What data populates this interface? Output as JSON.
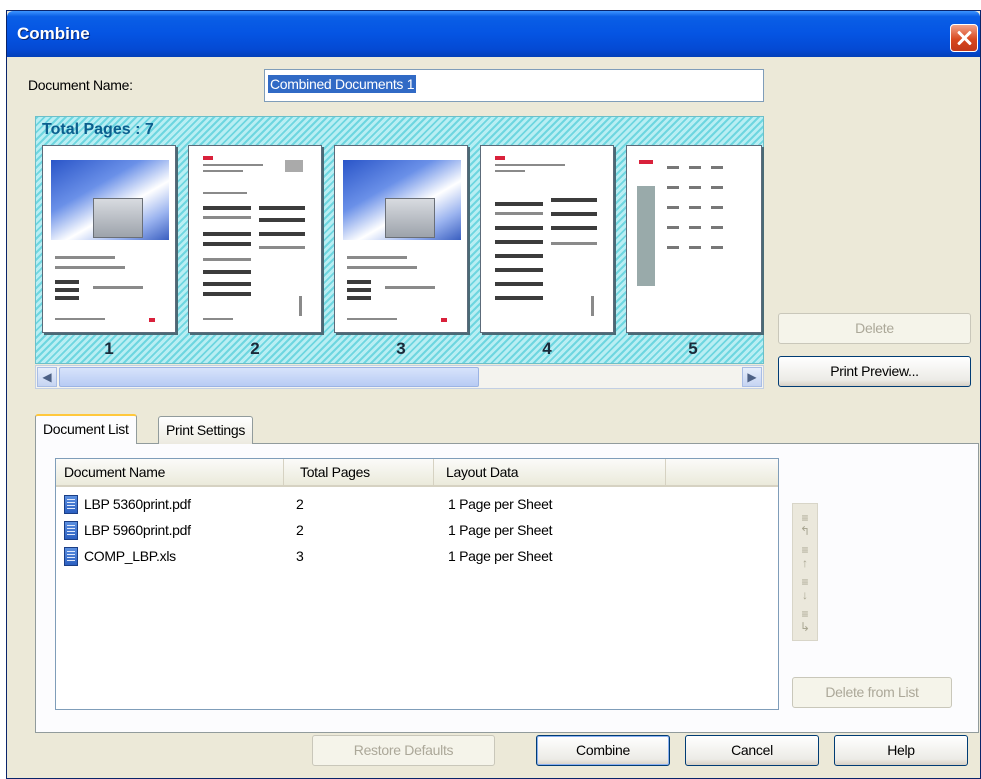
{
  "window": {
    "title": "Combine"
  },
  "document_name": {
    "label": "Document Name:",
    "value": "Combined Documents 1"
  },
  "preview": {
    "total_pages_label": "Total Pages : 7",
    "pages": [
      {
        "number": "1"
      },
      {
        "number": "2"
      },
      {
        "number": "3"
      },
      {
        "number": "4"
      },
      {
        "number": "5"
      }
    ]
  },
  "side_buttons": {
    "delete": "Delete",
    "print_preview": "Print Preview..."
  },
  "tabs": [
    {
      "label": "Document List"
    },
    {
      "label": "Print Settings"
    }
  ],
  "document_list": {
    "columns": [
      "Document Name",
      "Total Pages",
      "Layout Data"
    ],
    "rows": [
      {
        "name": "LBP 5360print.pdf",
        "pages": "2",
        "layout": "1 Page per Sheet"
      },
      {
        "name": "LBP 5960print.pdf",
        "pages": "2",
        "layout": "1 Page per Sheet"
      },
      {
        "name": "COMP_LBP.xls",
        "pages": "3",
        "layout": "1 Page per Sheet"
      }
    ],
    "delete_from_list": "Delete from List"
  },
  "footer": {
    "restore_defaults": "Restore Defaults",
    "combine": "Combine",
    "cancel": "Cancel",
    "help": "Help"
  },
  "colors": {
    "title_bar": "#0554e3",
    "preview_background": "#6ed6e0",
    "selection": "#316ac5"
  }
}
